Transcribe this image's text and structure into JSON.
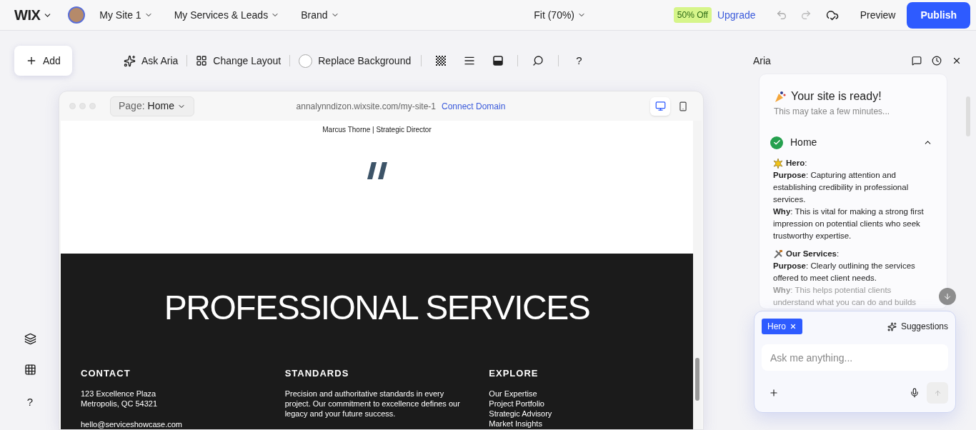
{
  "top_bar": {
    "logo": "WIX",
    "site_menus": [
      {
        "label": "My Site 1"
      },
      {
        "label": "My Services & Leads"
      },
      {
        "label": "Brand"
      }
    ],
    "zoom": "Fit (70%)",
    "promo_badge": "50% Off",
    "upgrade": "Upgrade",
    "preview": "Preview",
    "publish": "Publish"
  },
  "toolbar": {
    "add": "Add",
    "actions": [
      {
        "kind": "sparkle",
        "label": "Ask Aria"
      },
      {
        "kind": "layout",
        "label": "Change Layout"
      },
      {
        "kind": "circle",
        "label": "Replace Background"
      }
    ],
    "help": "?"
  },
  "canvas": {
    "page_label": "Page:",
    "page_value": "Home",
    "url": "annalynndizon.wixsite.com/my-site-1",
    "connect_domain": "Connect Domain",
    "devices": [
      {
        "kind": "desktop",
        "selected": true
      },
      {
        "kind": "mobile",
        "selected": false
      }
    ]
  },
  "site": {
    "caption": "Marcus Thorne | Strategic Director",
    "heading": "PROFESSIONAL SERVICES",
    "footer_columns": [
      {
        "title": "CONTACT",
        "groups": [
          [
            "123 Excellence Plaza",
            "Metropolis, QC 54321"
          ],
          [
            "hello@serviceshowcase.com"
          ]
        ]
      },
      {
        "title": "STANDARDS",
        "groups": [
          [
            "Precision and authoritative standards in every project. Our commitment to excellence defines our legacy and your future success."
          ]
        ]
      },
      {
        "title": "EXPLORE",
        "groups": [
          [
            "Our Expertise",
            "Project Portfolio",
            "Strategic Advisory",
            "Market Insights"
          ]
        ]
      }
    ]
  },
  "left_tools": {
    "help": "?"
  },
  "aria": {
    "title": "Aria",
    "status_title": "Your site is ready!",
    "status_subtitle": "This may take a few minutes...",
    "section": {
      "title": "Home",
      "expanded": true
    },
    "blocks": [
      {
        "kind": "hero",
        "name": "**Hero**:",
        "lines": [
          "**Purpose**: Capturing attention and establishing credibility in professional services.",
          "**Why**: This is vital for making a strong first impression on potential clients who seek trustworthy expertise."
        ]
      },
      {
        "kind": "services",
        "name": "**Our Services**:",
        "lines": [
          "**Purpose**: Clearly outlining the services offered to meet client needs.",
          "**Why**: This helps potential clients understand what you can do and builds"
        ]
      }
    ],
    "chip": "Hero",
    "suggestions": "Suggestions",
    "placeholder": "Ask me anything..."
  }
}
